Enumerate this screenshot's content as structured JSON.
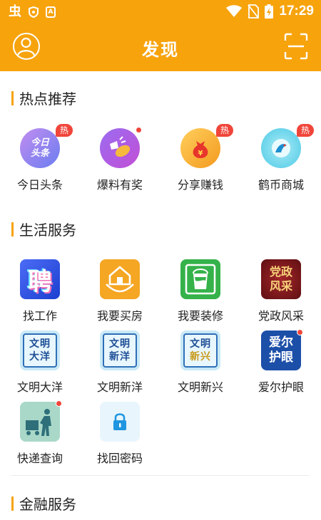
{
  "status_bar": {
    "time": "17:29",
    "app_glyph": "虫",
    "icon_a": "A"
  },
  "header": {
    "title": "发现"
  },
  "sections": {
    "hot": {
      "title": "热点推荐"
    },
    "life": {
      "title": "生活服务"
    },
    "finance": {
      "title": "金融服务"
    }
  },
  "hot_items": [
    {
      "label": "今日头条",
      "badge": "热",
      "icon": "news-icon",
      "tile_text": [
        "今日",
        "头条"
      ]
    },
    {
      "label": "爆料有奖",
      "badge": "",
      "icon": "megaphone-icon"
    },
    {
      "label": "分享赚钱",
      "badge": "热",
      "icon": "money-bag-icon"
    },
    {
      "label": "鹤币商城",
      "badge": "热",
      "icon": "bird-icon"
    }
  ],
  "life_items": [
    {
      "label": "找工作",
      "icon": "hire-icon",
      "tile_text": "聘"
    },
    {
      "label": "我要买房",
      "icon": "house-icon"
    },
    {
      "label": "我要装修",
      "icon": "paint-bucket-icon"
    },
    {
      "label": "党政风采",
      "icon": "party-icon",
      "tile_text": [
        "党政",
        "风采"
      ]
    },
    {
      "label": "文明大洋",
      "icon": "civilization-icon",
      "tile_text": [
        "文明",
        "大洋"
      ]
    },
    {
      "label": "文明新洋",
      "icon": "civilization-icon",
      "tile_text": [
        "文明",
        "新洋"
      ]
    },
    {
      "label": "文明新兴",
      "icon": "civilization-icon",
      "tile_text": [
        "文明",
        "新兴"
      ]
    },
    {
      "label": "爱尔护眼",
      "icon": "eye-care-icon",
      "tile_text": [
        "爱尔",
        "护眼"
      ]
    },
    {
      "label": "快递查询",
      "icon": "delivery-icon"
    },
    {
      "label": "找回密码",
      "icon": "lock-icon"
    }
  ],
  "colors": {
    "brand": "#f7a30c",
    "badge": "#f0453a"
  }
}
